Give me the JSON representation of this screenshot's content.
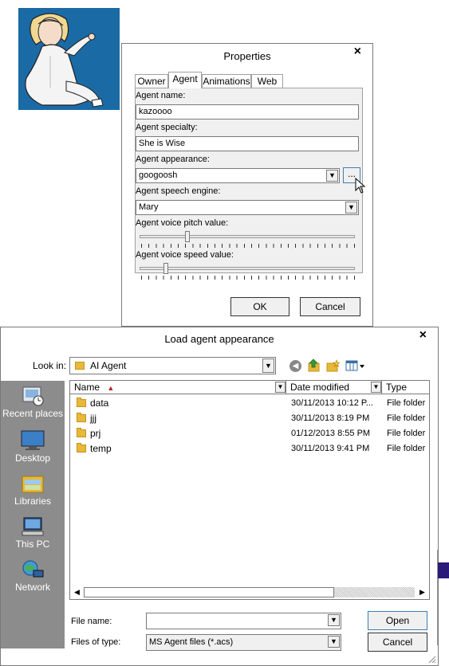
{
  "properties": {
    "title": "Properties",
    "close": "×",
    "tabs": [
      "Owner",
      "Agent",
      "Animations",
      "Web"
    ],
    "active_tab": "Agent",
    "agent_name_label": "Agent name:",
    "agent_name_value": "kazoooo",
    "agent_specialty_label": "Agent specialty:",
    "agent_specialty_value": "She is Wise",
    "agent_appearance_label": "Agent appearance:",
    "agent_appearance_value": "googoosh",
    "browse_label": "...",
    "speech_engine_label": "Agent speech engine:",
    "speech_engine_value": "Mary",
    "pitch_label": "Agent voice pitch value:",
    "pitch_level": 0.21,
    "speed_label": "Agent voice speed value:",
    "speed_level": 0.11,
    "ok_label": "OK",
    "cancel_label": "Cancel"
  },
  "load": {
    "title": "Load agent appearance",
    "close": "×",
    "lookin_label": "Look in:",
    "lookin_value": "AI Agent",
    "places": [
      "Recent places",
      "Desktop",
      "Libraries",
      "This PC",
      "Network"
    ],
    "columns": {
      "name": "Name",
      "date": "Date modified",
      "type": "Type"
    },
    "rows": [
      {
        "name": "data",
        "date": "30/11/2013 10:12 P...",
        "type": "File folder"
      },
      {
        "name": "jjj",
        "date": "30/11/2013 8:19 PM",
        "type": "File folder"
      },
      {
        "name": "prj",
        "date": "01/12/2013 8:55 PM",
        "type": "File folder"
      },
      {
        "name": "temp",
        "date": "30/11/2013 9:41 PM",
        "type": "File folder"
      }
    ],
    "filename_label": "File name:",
    "filename_value": "",
    "filetype_label": "Files of type:",
    "filetype_value": "MS Agent files (*.acs)",
    "open_label": "Open",
    "cancel_label": "Cancel"
  },
  "colors": {
    "agent_bg": "#1a6aa6",
    "places_bg": "#8c8c8c",
    "folder": "#e8b838"
  }
}
